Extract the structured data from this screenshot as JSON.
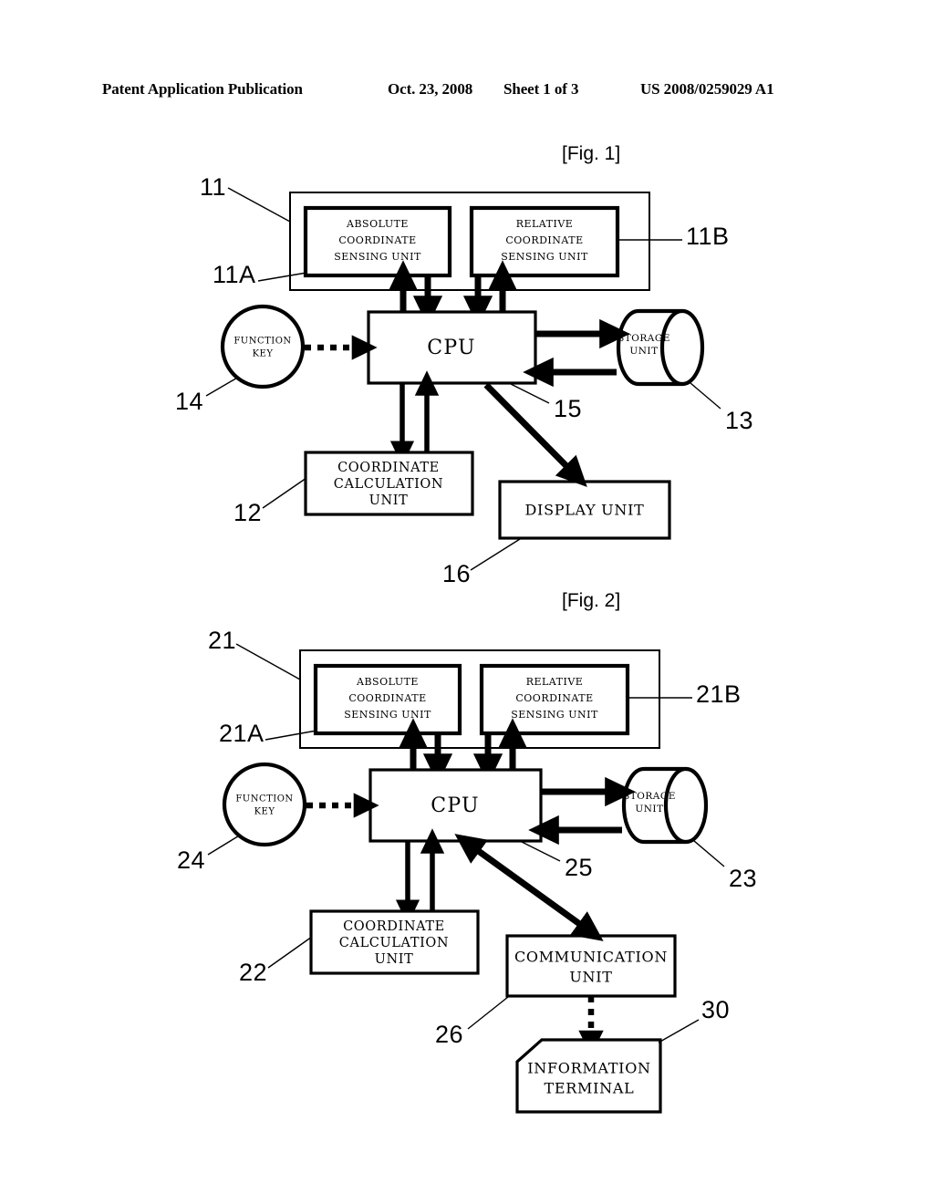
{
  "header": {
    "publication": "Patent Application Publication",
    "date": "Oct. 23, 2008",
    "sheet": "Sheet 1 of 3",
    "patent_number": "US 2008/0259029 A1"
  },
  "figures": [
    {
      "caption": "[Fig. 1]",
      "blocks": {
        "absolute_sensing": "ABSOLUTE\nCOORDINATE\nSENSING UNIT",
        "absolute_sensing_lines": [
          "ABSOLUTE",
          "COORDINATE",
          "SENSING UNIT"
        ],
        "relative_sensing_lines": [
          "RELATIVE",
          "COORDINATE",
          "SENSING UNIT"
        ],
        "cpu": "CPU",
        "function_key_lines": [
          "FUNCTION",
          "KEY"
        ],
        "storage_lines": [
          "STORAGE",
          "UNIT"
        ],
        "coordinate_calc_lines": [
          "COORDINATE",
          "CALCULATION",
          "UNIT"
        ],
        "display": "DISPLAY UNIT"
      },
      "ref_numbers": {
        "sensing_container": "11",
        "absolute_unit": "11A",
        "relative_unit": "11B",
        "coordinate_calc": "12",
        "storage": "13",
        "function_key": "14",
        "cpu": "15",
        "display": "16"
      }
    },
    {
      "caption": "[Fig. 2]",
      "blocks": {
        "absolute_sensing_lines": [
          "ABSOLUTE",
          "COORDINATE",
          "SENSING UNIT"
        ],
        "relative_sensing_lines": [
          "RELATIVE",
          "COORDINATE",
          "SENSING UNIT"
        ],
        "cpu": "CPU",
        "function_key_lines": [
          "FUNCTION",
          "KEY"
        ],
        "storage_lines": [
          "STORAGE",
          "UNIT"
        ],
        "coordinate_calc_lines": [
          "COORDINATE",
          "CALCULATION",
          "UNIT"
        ],
        "communication_lines": [
          "COMMUNICATION",
          "UNIT"
        ],
        "information_terminal_lines": [
          "INFORMATION",
          "TERMINAL"
        ]
      },
      "ref_numbers": {
        "sensing_container": "21",
        "absolute_unit": "21A",
        "relative_unit": "21B",
        "coordinate_calc": "22",
        "storage": "23",
        "function_key": "24",
        "cpu": "25",
        "communication": "26",
        "information_terminal": "30"
      }
    }
  ],
  "colors": {
    "ink": "#000000",
    "paper": "#ffffff"
  }
}
